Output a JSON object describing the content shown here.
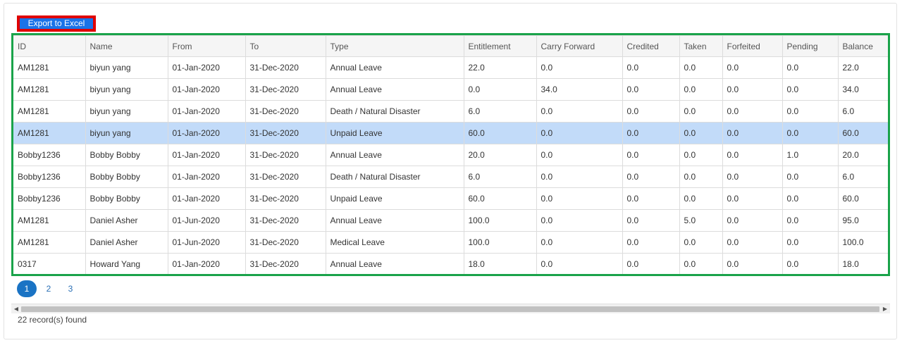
{
  "toolbar": {
    "export_label": "Export to Excel"
  },
  "table": {
    "headers": [
      "ID",
      "Name",
      "From",
      "To",
      "Type",
      "Entitlement",
      "Carry Forward",
      "Credited",
      "Taken",
      "Forfeited",
      "Pending",
      "Balance"
    ],
    "rows": [
      [
        "AM1281",
        "biyun yang",
        "01-Jan-2020",
        "31-Dec-2020",
        "Annual Leave",
        "22.0",
        "0.0",
        "0.0",
        "0.0",
        "0.0",
        "0.0",
        "22.0"
      ],
      [
        "AM1281",
        "biyun yang",
        "01-Jan-2020",
        "31-Dec-2020",
        "Annual Leave",
        "0.0",
        "34.0",
        "0.0",
        "0.0",
        "0.0",
        "0.0",
        "34.0"
      ],
      [
        "AM1281",
        "biyun yang",
        "01-Jan-2020",
        "31-Dec-2020",
        "Death / Natural Disaster",
        "6.0",
        "0.0",
        "0.0",
        "0.0",
        "0.0",
        "0.0",
        "6.0"
      ],
      [
        "AM1281",
        "biyun yang",
        "01-Jan-2020",
        "31-Dec-2020",
        "Unpaid Leave",
        "60.0",
        "0.0",
        "0.0",
        "0.0",
        "0.0",
        "0.0",
        "60.0"
      ],
      [
        "Bobby1236",
        "Bobby Bobby",
        "01-Jan-2020",
        "31-Dec-2020",
        "Annual Leave",
        "20.0",
        "0.0",
        "0.0",
        "0.0",
        "0.0",
        "1.0",
        "20.0"
      ],
      [
        "Bobby1236",
        "Bobby Bobby",
        "01-Jan-2020",
        "31-Dec-2020",
        "Death / Natural Disaster",
        "6.0",
        "0.0",
        "0.0",
        "0.0",
        "0.0",
        "0.0",
        "6.0"
      ],
      [
        "Bobby1236",
        "Bobby Bobby",
        "01-Jan-2020",
        "31-Dec-2020",
        "Unpaid Leave",
        "60.0",
        "0.0",
        "0.0",
        "0.0",
        "0.0",
        "0.0",
        "60.0"
      ],
      [
        "AM1281",
        "Daniel Asher",
        "01-Jun-2020",
        "31-Dec-2020",
        "Annual Leave",
        "100.0",
        "0.0",
        "0.0",
        "5.0",
        "0.0",
        "0.0",
        "95.0"
      ],
      [
        "AM1281",
        "Daniel Asher",
        "01-Jun-2020",
        "31-Dec-2020",
        "Medical Leave",
        "100.0",
        "0.0",
        "0.0",
        "0.0",
        "0.0",
        "0.0",
        "100.0"
      ],
      [
        "0317",
        "Howard Yang",
        "01-Jan-2020",
        "31-Dec-2020",
        "Annual Leave",
        "18.0",
        "0.0",
        "0.0",
        "0.0",
        "0.0",
        "0.0",
        "18.0"
      ]
    ],
    "selected_row": 3
  },
  "pagination": {
    "pages": [
      "1",
      "2",
      "3"
    ],
    "current": "1"
  },
  "scrollbar": {
    "left_arrow": "◀",
    "right_arrow": "▶"
  },
  "footer": {
    "records_text": "22 record(s) found"
  },
  "colors": {
    "export_button": "#1a73e8",
    "export_highlight": "#e00000",
    "grid_highlight": "#1aa34a",
    "selected_row": "#c2dbf9",
    "active_page": "#1a73c4"
  }
}
